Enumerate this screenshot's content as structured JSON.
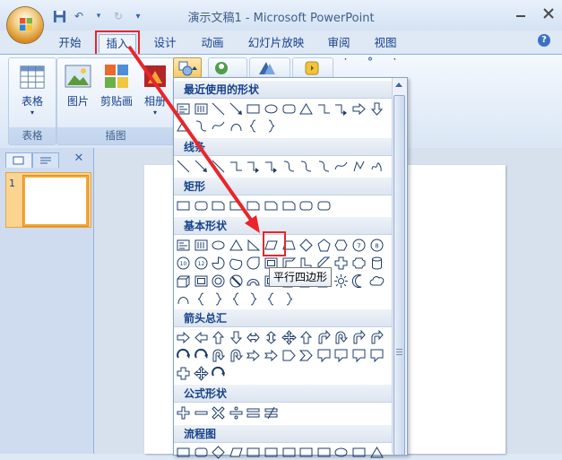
{
  "window": {
    "title": "演示文稿1 - Microsoft PowerPoint"
  },
  "quick_access": {
    "undo_glyph": "↶",
    "redo_glyph": "↻",
    "more_glyph": "▾"
  },
  "tabs": [
    {
      "label": "开始"
    },
    {
      "label": "插入"
    },
    {
      "label": "设计"
    },
    {
      "label": "动画"
    },
    {
      "label": "幻灯片放映"
    },
    {
      "label": "审阅"
    },
    {
      "label": "视图"
    }
  ],
  "ribbon": {
    "groups": [
      {
        "label": "表格"
      },
      {
        "label": "插图"
      }
    ],
    "buttons": {
      "table": "表格",
      "picture": "图片",
      "clipart": "剪贴画",
      "album": "相册"
    }
  },
  "shapes_menu": {
    "categories": [
      "最近使用的形状",
      "线条",
      "矩形",
      "基本形状",
      "箭头总汇",
      "公式形状",
      "流程图"
    ]
  },
  "tooltip": "平行四边形",
  "slides": {
    "number": "1"
  },
  "colors": {
    "accent": "#15428b",
    "highlight": "#e8262b"
  }
}
